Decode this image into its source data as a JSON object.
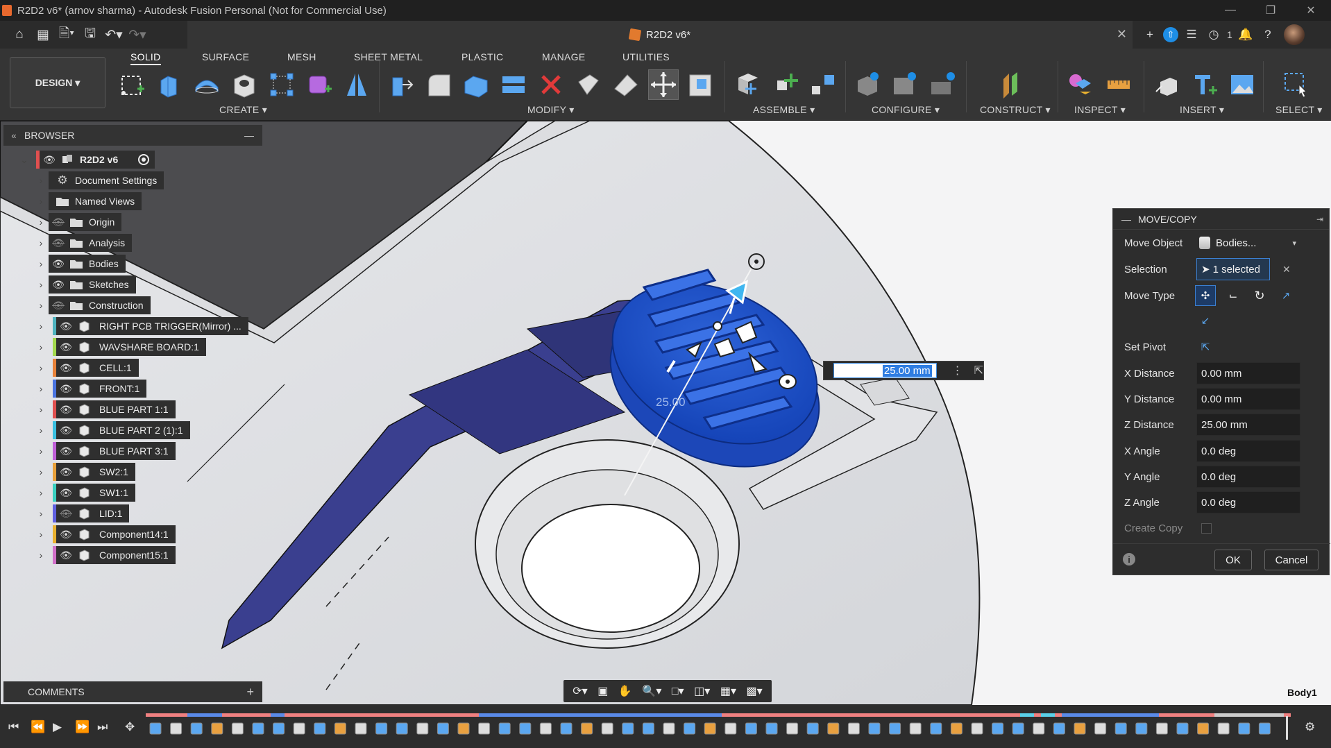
{
  "window": {
    "title": "R2D2 v6* (arnov sharma) - Autodesk Fusion Personal (Not for Commercial Use)"
  },
  "document_tab": {
    "title": "R2D2 v6*"
  },
  "header_right": {
    "job_count": "1"
  },
  "toolbar": {
    "workspace": "DESIGN",
    "tabs": [
      "SOLID",
      "SURFACE",
      "MESH",
      "SHEET METAL",
      "PLASTIC",
      "MANAGE",
      "UTILITIES"
    ],
    "groups": {
      "create": "CREATE",
      "modify": "MODIFY",
      "assemble": "ASSEMBLE",
      "configure": "CONFIGURE",
      "construct": "CONSTRUCT",
      "inspect": "INSPECT",
      "insert": "INSERT",
      "select": "SELECT"
    }
  },
  "browser": {
    "title": "BROWSER",
    "root": "R2D2 v6",
    "items": [
      {
        "label": "Document Settings",
        "icon": "gear-icon",
        "eye": "none"
      },
      {
        "label": "Named Views",
        "icon": "folder-icon",
        "eye": "none"
      },
      {
        "label": "Origin",
        "icon": "folder-icon",
        "eye": "hidden"
      },
      {
        "label": "Analysis",
        "icon": "folder-icon",
        "eye": "hidden"
      },
      {
        "label": "Bodies",
        "icon": "folder-icon",
        "eye": "visible"
      },
      {
        "label": "Sketches",
        "icon": "folder-icon",
        "eye": "visible"
      },
      {
        "label": "Construction",
        "icon": "folder-icon",
        "eye": "hidden"
      },
      {
        "label": "RIGHT PCB TRIGGER(Mirror) ...",
        "icon": "component-icon",
        "eye": "visible",
        "color": "#4fb3bf"
      },
      {
        "label": "WAVSHARE BOARD:1",
        "icon": "component-icon",
        "eye": "visible",
        "color": "#a3d94e"
      },
      {
        "label": "CELL:1",
        "icon": "component-icon",
        "eye": "visible",
        "color": "#e8823a"
      },
      {
        "label": "FRONT:1",
        "icon": "component-icon",
        "eye": "visible",
        "color": "#4a74e0"
      },
      {
        "label": "BLUE PART 1:1",
        "icon": "component-icon",
        "eye": "visible",
        "color": "#e05050"
      },
      {
        "label": "BLUE PART 2 (1):1",
        "icon": "component-icon",
        "eye": "visible",
        "color": "#3ac0e0"
      },
      {
        "label": "BLUE PART 3:1",
        "icon": "component-icon",
        "eye": "visible",
        "color": "#c060d8"
      },
      {
        "label": "SW2:1",
        "icon": "component-icon",
        "eye": "visible",
        "color": "#e8a03a"
      },
      {
        "label": "SW1:1",
        "icon": "component-icon",
        "eye": "visible",
        "color": "#3ad0c0"
      },
      {
        "label": "LID:1",
        "icon": "component-icon",
        "eye": "hidden",
        "color": "#6060e0"
      },
      {
        "label": "Component14:1",
        "icon": "component-icon",
        "eye": "visible",
        "color": "#e8b030"
      },
      {
        "label": "Component15:1",
        "icon": "component-icon",
        "eye": "visible",
        "color": "#d070c8"
      }
    ]
  },
  "viewport": {
    "dimension_label": "25.00",
    "input_value": "25.00 mm",
    "status_body": "Body1"
  },
  "move_copy": {
    "title": "MOVE/COPY",
    "move_object_label": "Move Object",
    "move_object_value": "Bodies...",
    "selection_label": "Selection",
    "selection_value": "1 selected",
    "move_type_label": "Move Type",
    "set_pivot_label": "Set Pivot",
    "x_distance_label": "X Distance",
    "x_distance": "0.00 mm",
    "y_distance_label": "Y Distance",
    "y_distance": "0.00 mm",
    "z_distance_label": "Z Distance",
    "z_distance": "25.00 mm",
    "x_angle_label": "X Angle",
    "x_angle": "0.0 deg",
    "y_angle_label": "Y Angle",
    "y_angle": "0.0 deg",
    "z_angle_label": "Z Angle",
    "z_angle": "0.0 deg",
    "create_copy_label": "Create Copy",
    "ok_label": "OK",
    "cancel_label": "Cancel"
  },
  "comments": {
    "title": "COMMENTS"
  },
  "colors": {
    "accent": "#1e6fd9",
    "selection_blue": "#1d4fc4",
    "panel": "#2d2d2d"
  }
}
